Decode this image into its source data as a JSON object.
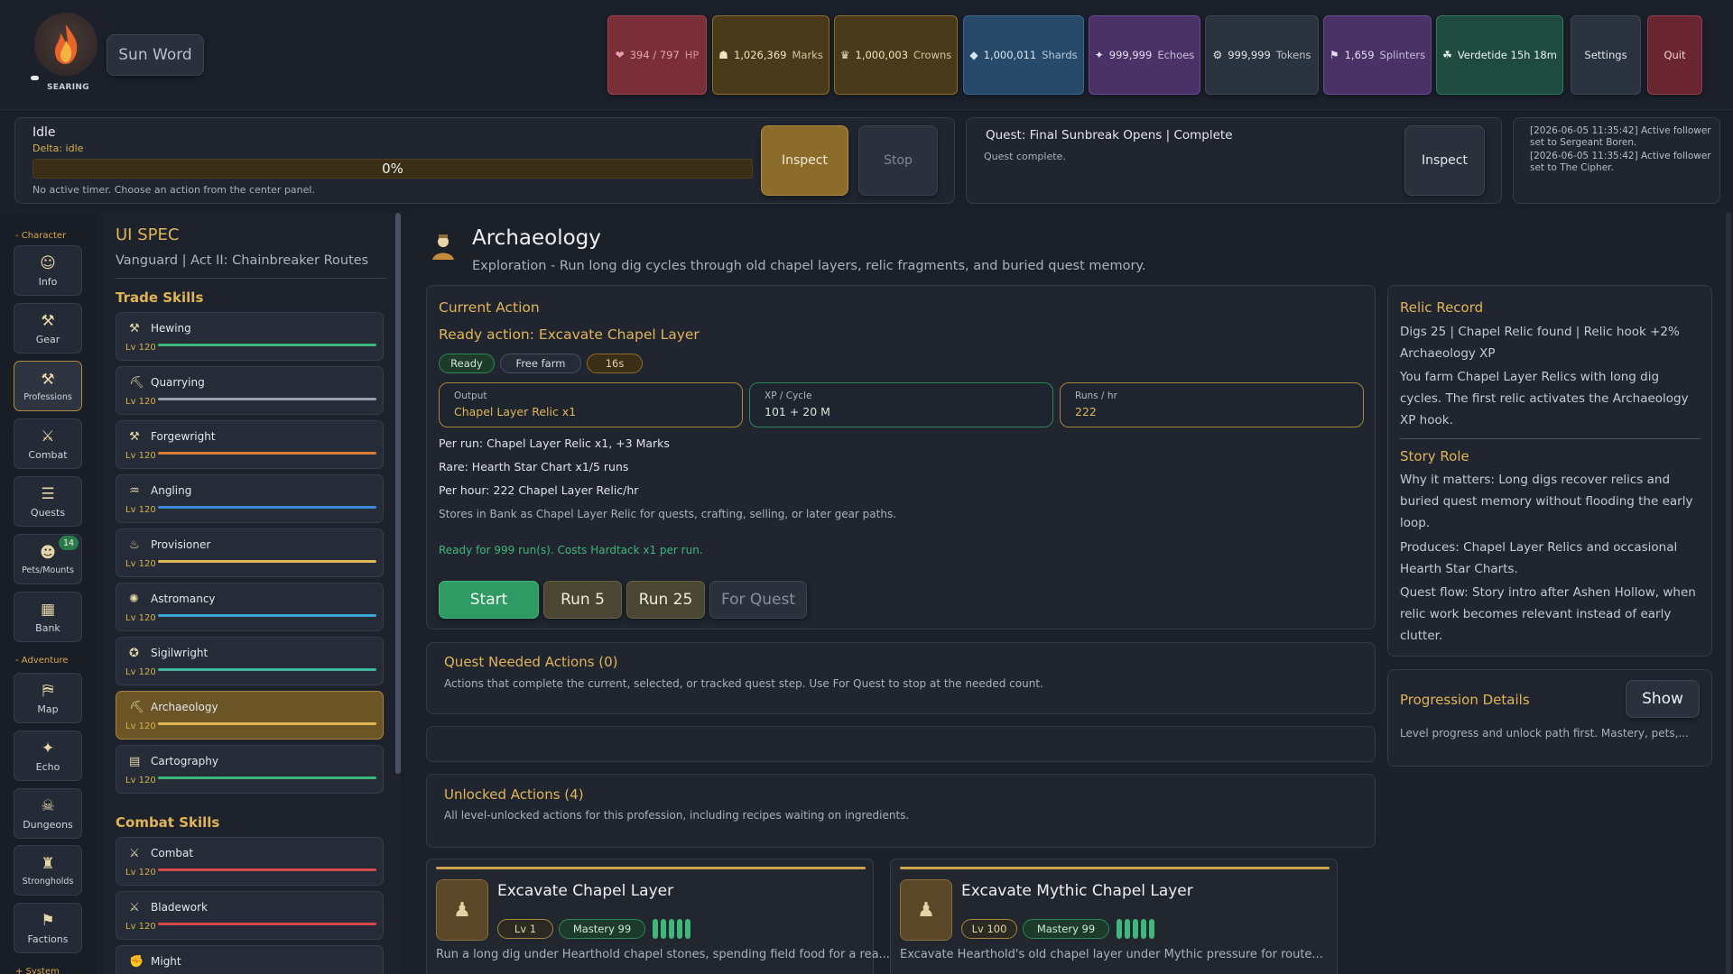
{
  "header": {
    "flame_label": "SEARING",
    "sun_word": "Sun Word",
    "resources": [
      {
        "icon": "heart-icon",
        "glyph": "❤",
        "value": "394 / 797",
        "label": "HP",
        "bg": "#7a2e38",
        "border": "#a04452",
        "color": "#e6a4ad"
      },
      {
        "icon": "marks-icon",
        "glyph": "☗",
        "value": "1,026,369",
        "label": "Marks",
        "bg": "#4a3a1c",
        "border": "#8c6c2a",
        "color": "#f1e3bd"
      },
      {
        "icon": "crown-icon",
        "glyph": "♛",
        "value": "1,000,003",
        "label": "Crowns",
        "bg": "#4a3a1c",
        "border": "#8c6c2a",
        "color": "#f1e3bd"
      },
      {
        "icon": "shard-icon",
        "glyph": "◆",
        "value": "1,000,011",
        "label": "Shards",
        "bg": "#274a6a",
        "border": "#3a6a94",
        "color": "#d8e6f4"
      },
      {
        "icon": "echo-icon",
        "glyph": "✦",
        "value": "999,999",
        "label": "Echoes",
        "bg": "#4a3266",
        "border": "#6a4a94",
        "color": "#e6dcf4"
      },
      {
        "icon": "token-icon",
        "glyph": "⚙",
        "value": "999,999",
        "label": "Tokens",
        "bg": "#2c3340",
        "border": "#3e4656",
        "color": "#e0e3e8"
      },
      {
        "icon": "splinter-icon",
        "glyph": "⚑",
        "value": "1,659",
        "label": "Splinters",
        "bg": "#4a3266",
        "border": "#6a4a94",
        "color": "#e6dcf4"
      },
      {
        "icon": "verdetide-icon",
        "glyph": "☘",
        "value": "Verdetide 15h 18m",
        "label": "",
        "bg": "#1f4a3e",
        "border": "#2f7a62",
        "color": "#e6f4ee"
      }
    ],
    "settings": "Settings",
    "quit": "Quit"
  },
  "status": {
    "title": "Idle",
    "delta": "Delta: idle",
    "progress": "0%",
    "progress_fraction": 0,
    "note": "No active timer. Choose an action from the center panel.",
    "inspect": "Inspect",
    "stop": "Stop"
  },
  "quest": {
    "title": "Quest: Final Sunbreak Opens | Complete",
    "sub": "Quest complete.",
    "inspect": "Inspect"
  },
  "log": [
    "[2026-06-05 11:35:42] Active follower set to Sergeant Boren.",
    "[2026-06-05 11:35:42] Active follower set to The Cipher."
  ],
  "nav": {
    "character_hdr": "- Character",
    "adventure_hdr": "- Adventure",
    "system_hdr": "+ System",
    "items": [
      {
        "name": "info",
        "label": "Info",
        "glyph": "☺"
      },
      {
        "name": "gear",
        "label": "Gear",
        "glyph": "⚒"
      },
      {
        "name": "professions",
        "label": "Professions",
        "glyph": "⚒"
      },
      {
        "name": "combat",
        "label": "Combat",
        "glyph": "⚔"
      },
      {
        "name": "quests",
        "label": "Quests",
        "glyph": "☰"
      },
      {
        "name": "pets-mounts",
        "label": "Pets/Mounts",
        "glyph": "☻"
      },
      {
        "name": "bank",
        "label": "Bank",
        "glyph": "▦"
      },
      {
        "name": "map",
        "label": "Map",
        "glyph": "⛿"
      },
      {
        "name": "echo",
        "label": "Echo",
        "glyph": "✦"
      },
      {
        "name": "dungeons",
        "label": "Dungeons",
        "glyph": "☠"
      },
      {
        "name": "strongholds",
        "label": "Strongholds",
        "glyph": "♜"
      },
      {
        "name": "factions",
        "label": "Factions",
        "glyph": "⚑"
      }
    ],
    "pets_badge": "14"
  },
  "spec": {
    "title": "UI SPEC",
    "sub": "Vanguard | Act II: Chainbreaker Routes",
    "trade_hdr": "Trade Skills",
    "combat_hdr": "Combat Skills",
    "trade": [
      {
        "name": "Hewing",
        "lv": "Lv 120",
        "glyph": "⚒",
        "color": "#3fb67a"
      },
      {
        "name": "Quarrying",
        "lv": "Lv 120",
        "glyph": "⛏",
        "color": "#9aa0aa"
      },
      {
        "name": "Forgewright",
        "lv": "Lv 120",
        "glyph": "⚒",
        "color": "#d87a3a"
      },
      {
        "name": "Angling",
        "lv": "Lv 120",
        "glyph": "♒",
        "color": "#3a8ad8"
      },
      {
        "name": "Provisioner",
        "lv": "Lv 120",
        "glyph": "♨",
        "color": "#e0b555"
      },
      {
        "name": "Astromancy",
        "lv": "Lv 120",
        "glyph": "✺",
        "color": "#3aa8d8"
      },
      {
        "name": "Sigilwright",
        "lv": "Lv 120",
        "glyph": "✪",
        "color": "#3fb6a0"
      },
      {
        "name": "Archaeology",
        "lv": "Lv 120",
        "glyph": "⛏",
        "color": "#e0b555"
      },
      {
        "name": "Cartography",
        "lv": "Lv 120",
        "glyph": "▤",
        "color": "#3fb67a"
      }
    ],
    "combat": [
      {
        "name": "Combat",
        "lv": "Lv 120",
        "glyph": "⚔",
        "color": "#d84a4a"
      },
      {
        "name": "Bladework",
        "lv": "Lv 120",
        "glyph": "⚔",
        "color": "#d84a4a"
      },
      {
        "name": "Might",
        "lv": "",
        "glyph": "✊",
        "color": "#d84a4a"
      }
    ]
  },
  "main": {
    "title": "Archaeology",
    "sub": "Exploration - Run long dig cycles through old chapel layers, relic fragments, and buried quest memory.",
    "current_hdr": "Current Action",
    "ready_action": "Ready action: Excavate Chapel Layer",
    "pills": [
      "Ready",
      "Free farm",
      "16s"
    ],
    "stats": [
      {
        "k": "Output",
        "v": "Chapel Layer Relic x1"
      },
      {
        "k": "XP / Cycle",
        "v": "101 + 20 M"
      },
      {
        "k": "Runs / hr",
        "v": "222"
      }
    ],
    "per_run": "Per run: Chapel Layer Relic x1, +3 Marks",
    "rare": "Rare: Hearth Star Chart x1/5 runs",
    "per_hour": "Per hour: 222 Chapel Layer Relic/hr",
    "stores": "Stores in Bank as Chapel Layer Relic for quests, crafting, selling, or later gear paths.",
    "ready_runs": "Ready for 999 run(s). Costs Hardtack x1 per run.",
    "buttons": {
      "start": "Start",
      "run5": "Run 5",
      "run25": "Run 25",
      "forquest": "For Quest"
    },
    "quest_needed_title": "Quest Needed Actions (0)",
    "quest_needed_sub": "Actions that complete the current, selected, or tracked quest step. Use For Quest to stop at the needed count.",
    "unlocked_title": "Unlocked Actions (4)",
    "unlocked_sub": "All level-unlocked actions for this profession, including recipes waiting on ingredients.",
    "cards": [
      {
        "title": "Excavate Chapel Layer",
        "lv": "Lv 1",
        "mastery": "Mastery 99",
        "desc": "Run a long dig under Hearthold chapel stones, spending field food for a rea..."
      },
      {
        "title": "Excavate Mythic Chapel Layer",
        "lv": "Lv 100",
        "mastery": "Mastery 99",
        "desc": "Excavate Hearthold's old chapel layer under Mythic pressure for route..."
      }
    ]
  },
  "right": {
    "relic_hdr": "Relic Record",
    "relic_text": "Digs 25 | Chapel Relic found | Relic hook +2% Archaeology XP",
    "relic_farm": "You farm Chapel Layer Relics with long dig cycles. The first relic activates the Archaeology XP hook.",
    "story_hdr": "Story Role",
    "why": "Why it matters: Long digs recover relics and buried quest memory without flooding the early loop.",
    "produces": "Produces: Chapel Layer Relics and occasional Hearth Star Charts.",
    "flow": "Quest flow: Story intro after Ashen Hollow, when relic work becomes relevant instead of early clutter.",
    "prog_hdr": "Progression Details",
    "show": "Show",
    "prog_sub": "Level progress and unlock path first. Mastery, pets,..."
  }
}
